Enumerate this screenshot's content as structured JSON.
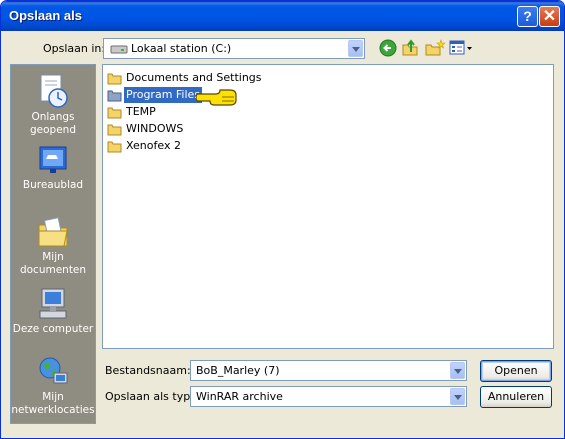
{
  "window": {
    "title": "Opslaan als",
    "help_glyph": "?",
    "close_glyph": "✕"
  },
  "toolbar": {
    "save_in_label": "Opslaan in:",
    "save_in_value": "Lokaal station (C:)",
    "icons": [
      "back-icon",
      "up-folder-icon",
      "new-folder-icon",
      "view-menu-icon"
    ]
  },
  "places": [
    {
      "label": "Onlangs geopend",
      "icon": "recent-documents-icon"
    },
    {
      "label": "Bureaublad",
      "icon": "desktop-icon"
    },
    {
      "label": "Mijn documenten",
      "icon": "my-documents-icon"
    },
    {
      "label": "Deze computer",
      "icon": "my-computer-icon"
    },
    {
      "label": "Mijn netwerklocaties",
      "icon": "network-places-icon"
    }
  ],
  "files": [
    {
      "name": "Documents and Settings",
      "selected": false
    },
    {
      "name": "Program Files",
      "selected": true
    },
    {
      "name": "TEMP",
      "selected": false
    },
    {
      "name": "WINDOWS",
      "selected": false
    },
    {
      "name": "Xenofex 2",
      "selected": false
    }
  ],
  "footer": {
    "filename_label": "Bestandsnaam:",
    "filename_value": "BoB_Marley (7)",
    "filetype_label": "Opslaan als type:",
    "filetype_value": "WinRAR archive",
    "open_button": "Openen",
    "cancel_button": "Annuleren"
  },
  "colors": {
    "titlebar": "#0054E3",
    "selection": "#316AC5",
    "dialog_bg": "#ECE9D8",
    "places_bg": "#8F8C81"
  }
}
